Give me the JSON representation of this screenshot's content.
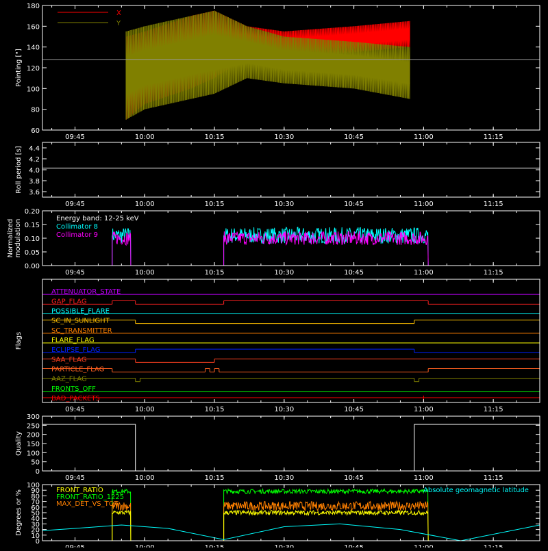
{
  "colors": {
    "background": "#000000",
    "axis": "#ffffff",
    "x_series": "#ff0000",
    "y_series": "#808000",
    "reference_line": "#999999",
    "collimator8": "#00ffff",
    "collimator9": "#ff00ff",
    "front_ratio": "#ffff00",
    "front_ratio_1225": "#00ff00",
    "max_det_vs_tot": "#ff8000",
    "geomag_lat": "#00ffff"
  },
  "time_ticks": [
    "09:45",
    "10:00",
    "10:15",
    "10:30",
    "10:45",
    "11:00",
    "11:15"
  ],
  "chart_data": [
    {
      "id": "pointing",
      "type": "line",
      "ylabel": "Pointing [\"]",
      "ylim": [
        60,
        180
      ],
      "yticks": [
        "60",
        "80",
        "100",
        "120",
        "140",
        "160",
        "180"
      ],
      "xlim": [
        "09:38",
        "11:25"
      ],
      "legend": "top-left",
      "reference_line": 128,
      "series": [
        {
          "name": "X",
          "x": [
            "09:56",
            "10:00",
            "10:10",
            "10:15",
            "10:22",
            "10:30",
            "10:45",
            "10:57"
          ],
          "high": [
            150,
            155,
            170,
            175,
            160,
            155,
            160,
            165
          ],
          "low": [
            70,
            85,
            100,
            110,
            130,
            130,
            135,
            140
          ]
        },
        {
          "name": "Y",
          "x": [
            "09:56",
            "10:00",
            "10:10",
            "10:15",
            "10:22",
            "10:30",
            "10:45",
            "10:57"
          ],
          "high": [
            155,
            160,
            170,
            175,
            160,
            150,
            145,
            140
          ],
          "low": [
            70,
            80,
            90,
            95,
            110,
            105,
            100,
            90
          ]
        }
      ]
    },
    {
      "id": "roll_period",
      "type": "line",
      "ylabel": "Roll period [s]",
      "ylim": [
        3.5,
        4.5
      ],
      "yticks": [
        "3.6",
        "3.8",
        "4.0",
        "4.2",
        "4.4"
      ],
      "series": [
        {
          "x": [
            "09:38",
            "11:25"
          ],
          "values": [
            4.03,
            4.03
          ]
        }
      ]
    },
    {
      "id": "modulation",
      "type": "line",
      "ylabel": "Normalized modulation",
      "ylim": [
        0,
        0.2
      ],
      "yticks": [
        "0.00",
        "0.05",
        "0.10",
        "0.15",
        "0.20"
      ],
      "annotation": "Energy band: 12-25 keV",
      "series": [
        {
          "name": "Collimator 8",
          "segments": [
            [
              "09:53",
              "09:57"
            ],
            [
              "10:17",
              "11:01"
            ]
          ],
          "mean": 0.11,
          "spread": 0.03
        },
        {
          "name": "Collimator 9",
          "segments": [
            [
              "09:53",
              "09:57"
            ],
            [
              "10:17",
              "11:01"
            ]
          ],
          "mean": 0.1,
          "spread": 0.025
        }
      ]
    },
    {
      "id": "flags",
      "type": "line",
      "ylabel": "Flags",
      "series": [
        {
          "name": "ATTENUATOR_STATE",
          "color": "#c000ff",
          "segments": [
            [
              "09:38",
              "11:25",
              0
            ]
          ]
        },
        {
          "name": "GAP_FLAG",
          "color": "#ff2020",
          "segments": [
            [
              "09:38",
              "09:53",
              0
            ],
            [
              "09:53",
              "09:58",
              1
            ],
            [
              "09:58",
              "10:17",
              0
            ],
            [
              "10:17",
              "11:01",
              1
            ],
            [
              "11:01",
              "11:25",
              0
            ]
          ]
        },
        {
          "name": "POSSIBLE_FLARE",
          "color": "#00ffff",
          "segments": [
            [
              "09:38",
              "11:25",
              0
            ]
          ]
        },
        {
          "name": "SC_IN_SUNLIGHT",
          "color": "#ffc000",
          "segments": [
            [
              "09:38",
              "09:58",
              1
            ],
            [
              "09:58",
              "10:58",
              0
            ],
            [
              "10:58",
              "11:25",
              1
            ]
          ]
        },
        {
          "name": "SC_TRANSMITTER",
          "color": "#ff8000",
          "segments": [
            [
              "09:38",
              "11:25",
              0
            ]
          ]
        },
        {
          "name": "FLARE_FLAG",
          "color": "#ffff00",
          "segments": [
            [
              "09:38",
              "11:25",
              0
            ]
          ]
        },
        {
          "name": "ECLIPSE_FLAG",
          "color": "#0020ff",
          "segments": [
            [
              "09:38",
              "09:58",
              0
            ],
            [
              "09:58",
              "10:58",
              1
            ],
            [
              "10:58",
              "11:25",
              0
            ]
          ]
        },
        {
          "name": "SAA_FLAG",
          "color": "#ff4020",
          "segments": [
            [
              "09:38",
              "09:58",
              1
            ],
            [
              "09:58",
              "10:15",
              0
            ],
            [
              "10:15",
              "11:25",
              1
            ]
          ]
        },
        {
          "name": "PARTICLE_FLAG",
          "color": "#ff6020",
          "segments": [
            [
              "09:38",
              "09:53",
              1
            ],
            [
              "09:53",
              "10:13",
              0
            ],
            [
              "10:13",
              "10:14",
              1
            ],
            [
              "10:14",
              "10:15",
              0
            ],
            [
              "10:15",
              "10:16",
              1
            ],
            [
              "10:16",
              "11:01",
              0
            ],
            [
              "11:01",
              "11:25",
              1
            ]
          ]
        },
        {
          "name": "AAZ_FLAG",
          "color": "#808000",
          "segments": [
            [
              "09:38",
              "09:58",
              1
            ],
            [
              "09:58",
              "09:59",
              0
            ],
            [
              "09:59",
              "10:58",
              1
            ],
            [
              "10:58",
              "10:59",
              0
            ],
            [
              "10:59",
              "11:25",
              1
            ]
          ]
        },
        {
          "name": "FRONTS_OFF",
          "color": "#00ff00",
          "segments": [
            [
              "09:38",
              "11:25",
              0
            ]
          ]
        },
        {
          "name": "BAD_PACKETS",
          "color": "#ff0000",
          "segments": [
            [
              "09:38",
              "11:25",
              1
            ]
          ],
          "spikes": [
            "11:00"
          ]
        }
      ]
    },
    {
      "id": "quality",
      "type": "line",
      "ylabel": "Quality",
      "ylim": [
        0,
        300
      ],
      "yticks": [
        "0",
        "50",
        "100",
        "150",
        "200",
        "250",
        "300"
      ],
      "series": [
        {
          "x": [
            "09:38",
            "09:58",
            "09:58",
            "10:58",
            "10:58",
            "11:25"
          ],
          "values": [
            255,
            255,
            0,
            0,
            255,
            255
          ]
        }
      ]
    },
    {
      "id": "ratios",
      "type": "line",
      "ylabel": "Degrees or %",
      "ylim": [
        0,
        100
      ],
      "yticks": [
        "0",
        "10",
        "20",
        "30",
        "40",
        "50",
        "60",
        "70",
        "80",
        "90",
        "100"
      ],
      "series": [
        {
          "name": "FRONT_RATIO",
          "segments": [
            [
              "09:53",
              "09:57"
            ],
            [
              "10:17",
              "11:01"
            ]
          ],
          "mean": 50
        },
        {
          "name": "FRONT_RATIO_1225",
          "segments": [
            [
              "09:53",
              "09:57"
            ],
            [
              "10:17",
              "11:01"
            ]
          ],
          "mean": 88
        },
        {
          "name": "MAX_DET_VS_TOT",
          "segments": [
            [
              "09:53",
              "09:57"
            ],
            [
              "10:17",
              "11:01"
            ]
          ],
          "mean": 62
        },
        {
          "name": "Absolute geomagnetic latitude",
          "x": [
            "09:38",
            "09:45",
            "09:55",
            "10:05",
            "10:17",
            "10:30",
            "10:42",
            "10:55",
            "11:08",
            "11:25"
          ],
          "values": [
            18,
            22,
            28,
            22,
            2,
            25,
            30,
            20,
            0,
            28
          ]
        }
      ]
    }
  ]
}
